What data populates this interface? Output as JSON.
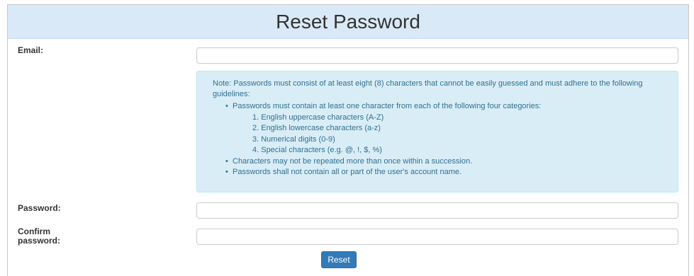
{
  "header": {
    "title": "Reset Password"
  },
  "form": {
    "email_label": "Email:",
    "email_value": "",
    "password_label": "Password:",
    "password_value": "",
    "confirm_label_line1": "Confirm",
    "confirm_label_line2": "password:",
    "confirm_value": "",
    "reset_label": "Reset"
  },
  "note": {
    "intro": "Note: Passwords must consist of at least eight (8) characters that cannot be easily guessed and must adhere to the following guidelines:",
    "rules": [
      "Passwords must contain at least one character from each of the following four categories:",
      "Characters may not be repeated more than once within a succession.",
      "Passwords shall not contain all or part of the user's account name."
    ],
    "categories": [
      "1.  English uppercase characters (A-Z)",
      "2.  English lowercase characters (a-z)",
      "3.  Numerical digits (0-9)",
      "4.  Special characters (e.g. @, !, $, %)"
    ]
  },
  "colors": {
    "header_bg": "#d9e9f7",
    "note_bg": "#d9edf7",
    "note_text": "#31708f",
    "button_bg": "#337ab7"
  }
}
